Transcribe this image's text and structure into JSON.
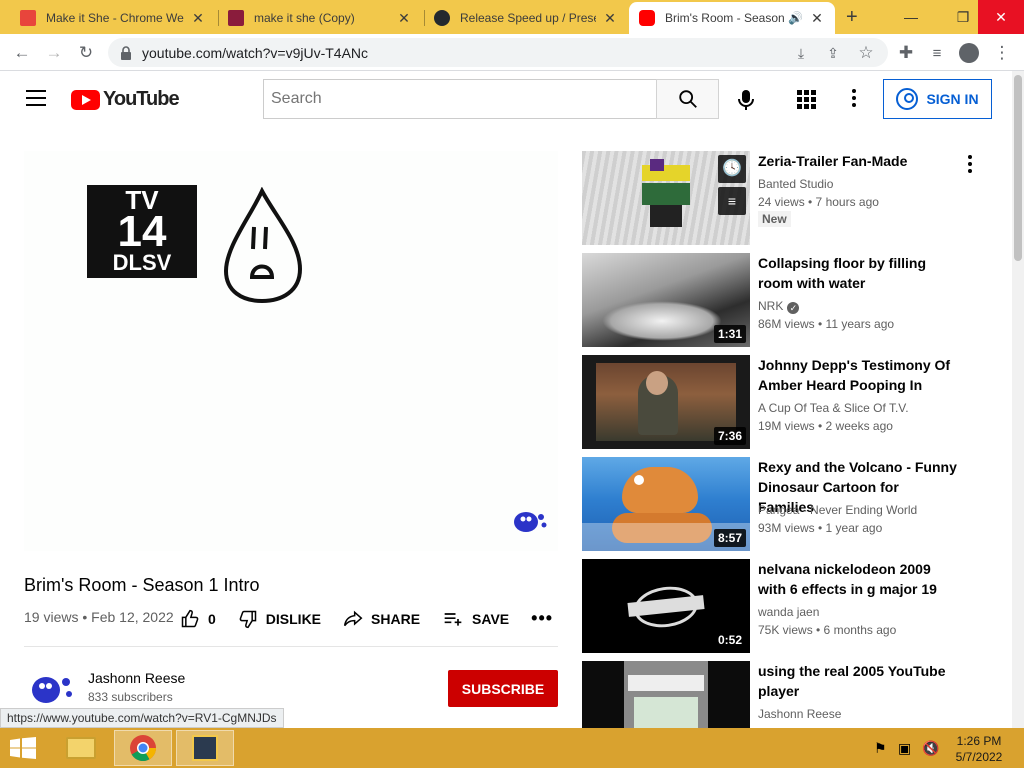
{
  "browser": {
    "tabs": [
      {
        "title": "Make it She - Chrome Web",
        "favicon_color": "#e8453c"
      },
      {
        "title": "make it she (Copy)",
        "favicon_color": "#8a1c3c"
      },
      {
        "title": "Release Speed up / Preset",
        "favicon_color": "#24292e"
      },
      {
        "title": "Brim's Room - Season",
        "favicon_color": "#ff0000"
      }
    ],
    "url": "youtube.com/watch?v=v9jUv-T4ANc"
  },
  "header": {
    "logo_text": "YouTube",
    "search_placeholder": "Search",
    "signin_label": "SIGN IN"
  },
  "player": {
    "rating_line1": "TV",
    "rating_line2": "14",
    "rating_line3": "DLSV"
  },
  "video": {
    "title": "Brim's Room - Season 1 Intro",
    "meta": "19 views • Feb 12, 2022",
    "like_count": "0",
    "dislike_label": "DISLIKE",
    "share_label": "SHARE",
    "save_label": "SAVE"
  },
  "channel": {
    "name": "Jashonn Reese",
    "subscribers": "833 subscribers",
    "subscribe_label": "SUBSCRIBE"
  },
  "status_url": "https://www.youtube.com/watch?v=RV1-CgMNJDs",
  "recommendations": [
    {
      "title": "Zeria-Trailer Fan-Made",
      "channel": "Banted Studio",
      "stats": "24 views • 7 hours ago",
      "badge": "New",
      "duration": ""
    },
    {
      "title": "Collapsing floor by filling room with water",
      "channel": "NRK",
      "stats": "86M views • 11 years ago",
      "badge": "",
      "duration": "1:31"
    },
    {
      "title": "Johnny Depp's Testimony Of Amber Heard Pooping In His…",
      "channel": "A Cup Of Tea & Slice Of T.V.",
      "stats": "19M views • 2 weeks ago",
      "badge": "",
      "duration": "7:36"
    },
    {
      "title": "Rexy and the Volcano - Funny Dinosaur Cartoon for Families",
      "channel": "Pangea - Never Ending World",
      "stats": "93M views • 1 year ago",
      "badge": "",
      "duration": "8:57"
    },
    {
      "title": "nelvana nickelodeon 2009 with 6 effects in g major 19",
      "channel": "wanda jaen",
      "stats": "75K views • 6 months ago",
      "badge": "",
      "duration": "0:52"
    },
    {
      "title": "using the real 2005 YouTube player",
      "channel": "Jashonn Reese",
      "stats": "",
      "badge": "",
      "duration": ""
    }
  ],
  "taskbar": {
    "time": "1:26 PM",
    "date": "5/7/2022"
  }
}
